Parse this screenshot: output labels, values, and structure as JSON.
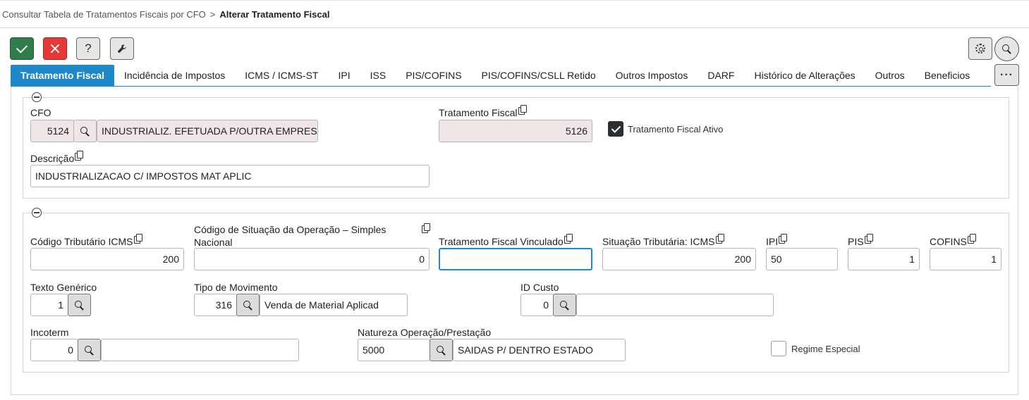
{
  "breadcrumb": {
    "parent": "Consultar Tabela de Tratamentos Fiscais por CFO",
    "separator": ">",
    "current": "Alterar Tratamento Fiscal"
  },
  "toolbar": {
    "help_label": "?",
    "more_label": "···"
  },
  "tabs": [
    {
      "label": "Tratamento Fiscal",
      "active": true
    },
    {
      "label": "Incidência de Impostos"
    },
    {
      "label": "ICMS / ICMS-ST"
    },
    {
      "label": "IPI"
    },
    {
      "label": "ISS"
    },
    {
      "label": "PIS/COFINS"
    },
    {
      "label": "PIS/COFINS/CSLL Retido"
    },
    {
      "label": "Outros Impostos"
    },
    {
      "label": "DARF"
    },
    {
      "label": "Histórico de Alterações"
    },
    {
      "label": "Outros"
    },
    {
      "label": "Beneficios"
    }
  ],
  "section1": {
    "cfo": {
      "label": "CFO",
      "code": "5124",
      "description": "INDUSTRIALIZ. EFETUADA P/OUTRA EMPRESA"
    },
    "tratamento_fiscal": {
      "label": "Tratamento Fiscal",
      "value": "5126"
    },
    "ativo": {
      "label": "Tratamento Fiscal Ativo",
      "checked": true
    },
    "descricao": {
      "label": "Descrição",
      "value": "INDUSTRIALIZACAO C/ IMPOSTOS MAT APLIC"
    }
  },
  "section2": {
    "codigo_tributario_icms": {
      "label": "Código Tributário ICMS",
      "value": "200"
    },
    "codigo_situacao_simples": {
      "label": "Código de Situação da Operação – Simples Nacional",
      "value": "0"
    },
    "tratamento_vinculado": {
      "label": "Tratamento Fiscal Vinculado",
      "value": ""
    },
    "situacao_tributaria_icms": {
      "label": "Situação Tributária: ICMS",
      "value": "200"
    },
    "ipi": {
      "label": "IPI",
      "value": "50"
    },
    "pis": {
      "label": "PIS",
      "value": "1"
    },
    "cofins": {
      "label": "COFINS",
      "value": "1"
    },
    "texto_generico": {
      "label": "Texto Genérico",
      "value": "1"
    },
    "tipo_movimento": {
      "label": "Tipo de Movimento",
      "code": "316",
      "description": "Venda de Material Aplicad"
    },
    "id_custo": {
      "label": "ID Custo",
      "code": "0",
      "description": ""
    },
    "incoterm": {
      "label": "Incoterm",
      "code": "0",
      "description": ""
    },
    "natureza_operacao": {
      "label": "Natureza Operação/Prestação",
      "code": "5000",
      "description": "SAIDAS P/ DENTRO ESTADO"
    },
    "regime_especial": {
      "label": "Regime Especial",
      "checked": false
    }
  }
}
